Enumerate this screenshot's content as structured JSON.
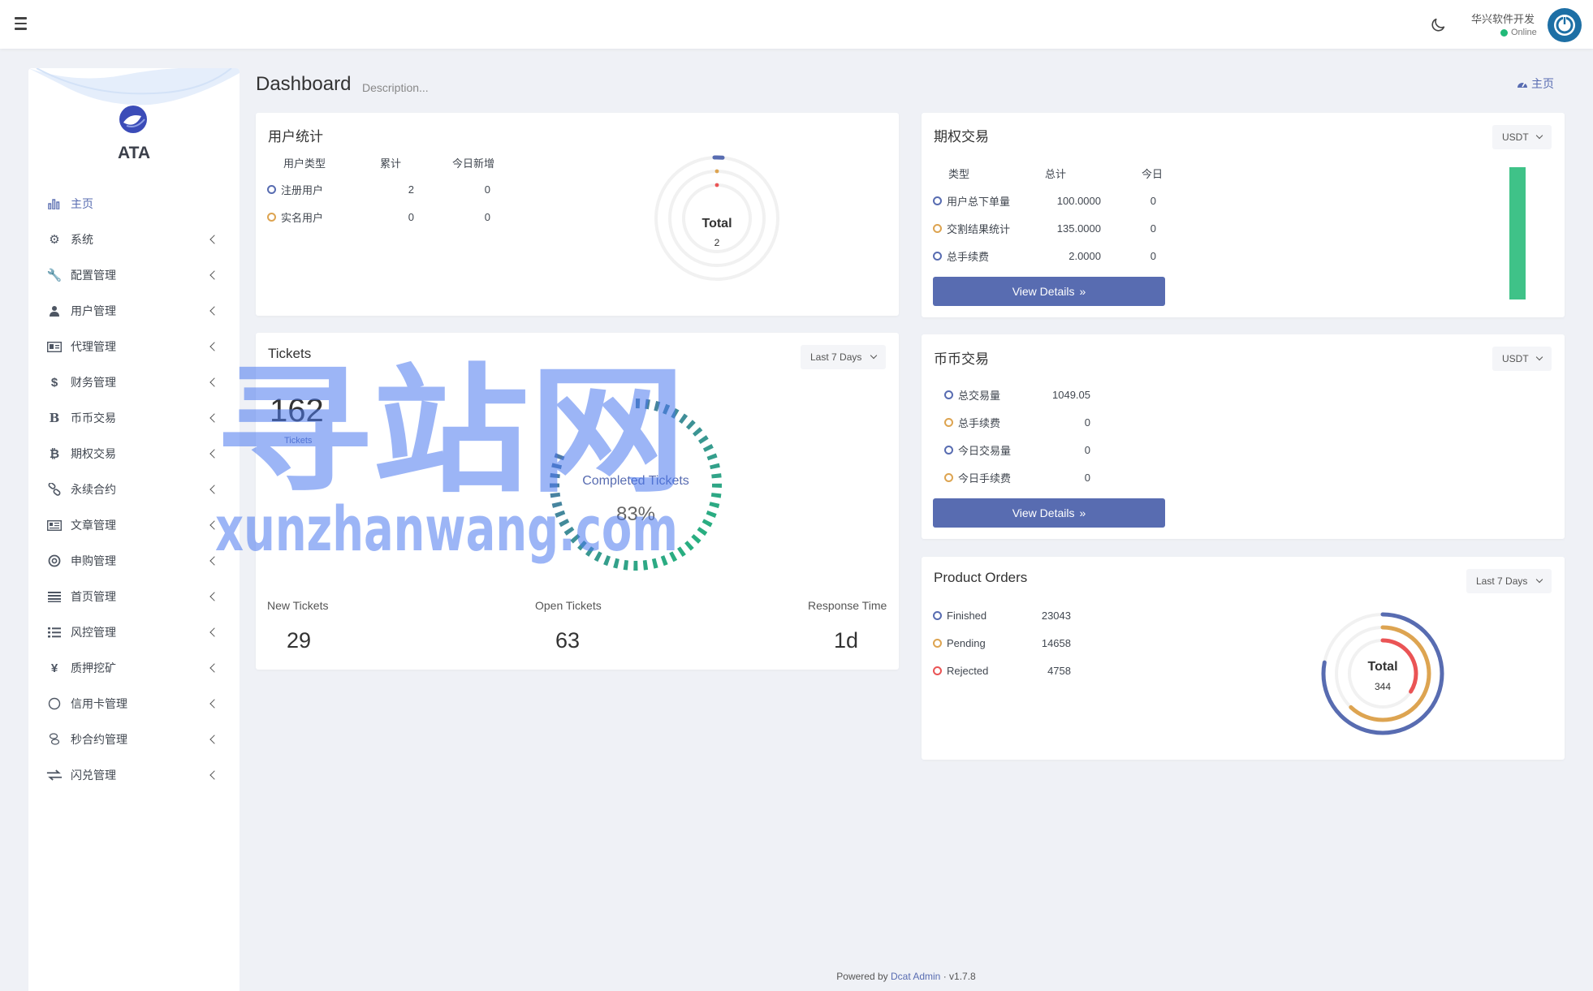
{
  "topbar": {
    "user_name": "华兴软件开发",
    "user_status": "Online"
  },
  "sidebar": {
    "logo_text": "ATA",
    "items": [
      {
        "label": "主页",
        "icon": "bar-chart-icon",
        "active": true
      },
      {
        "label": "系统",
        "icon": "gear-icon"
      },
      {
        "label": "配置管理",
        "icon": "wrench-icon"
      },
      {
        "label": "用户管理",
        "icon": "users-icon"
      },
      {
        "label": "代理管理",
        "icon": "id-card-icon"
      },
      {
        "label": "财务管理",
        "icon": "dollar-icon"
      },
      {
        "label": "币币交易",
        "icon": "bitcoin-b-icon"
      },
      {
        "label": "期权交易",
        "icon": "bitcoin-icon"
      },
      {
        "label": "永续合约",
        "icon": "link-icon"
      },
      {
        "label": "文章管理",
        "icon": "newspaper-icon"
      },
      {
        "label": "申购管理",
        "icon": "life-ring-icon"
      },
      {
        "label": "首页管理",
        "icon": "list-icon"
      },
      {
        "label": "风控管理",
        "icon": "list-ul-icon"
      },
      {
        "label": "质押挖矿",
        "icon": "yen-icon"
      },
      {
        "label": "信用卡管理",
        "icon": "circle-icon"
      },
      {
        "label": "秒合约管理",
        "icon": "money-icon"
      },
      {
        "label": "闪兑管理",
        "icon": "exchange-icon"
      }
    ]
  },
  "page": {
    "title": "Dashboard",
    "description": "Description...",
    "breadcrumb": "主页"
  },
  "user_stats": {
    "title": "用户统计",
    "headers": [
      "用户类型",
      "累计",
      "今日新增"
    ],
    "rows": [
      {
        "label": "注册用户",
        "total": "2",
        "today": "0",
        "color": "#586cb1"
      },
      {
        "label": "实名用户",
        "total": "0",
        "today": "0",
        "color": "#dda451"
      }
    ],
    "donut_label": "Total",
    "donut_value": "2"
  },
  "options_trade": {
    "title": "期权交易",
    "currency": "USDT",
    "headers": [
      "类型",
      "总计",
      "今日"
    ],
    "rows": [
      {
        "label": "用户总下单量",
        "total": "100.0000",
        "today": "0",
        "color": "#586cb1"
      },
      {
        "label": "交割结果统计",
        "total": "135.0000",
        "today": "0",
        "color": "#dda451"
      },
      {
        "label": "总手续费",
        "total": "2.0000",
        "today": "0",
        "color": "#586cb1"
      }
    ],
    "button": "View Details",
    "bar_color": "#3fc288"
  },
  "tickets": {
    "title": "Tickets",
    "range": "Last 7 Days",
    "count": "162",
    "count_label": "Tickets",
    "gauge_label": "Completed Tickets",
    "gauge_value": "83%",
    "stats": [
      {
        "label": "New Tickets",
        "value": "29"
      },
      {
        "label": "Open Tickets",
        "value": "63"
      },
      {
        "label": "Response Time",
        "value": "1d"
      }
    ]
  },
  "coin_trade": {
    "title": "币币交易",
    "currency": "USDT",
    "rows": [
      {
        "label": "总交易量",
        "value": "1049.05",
        "color": "#586cb1"
      },
      {
        "label": "总手续费",
        "value": "0",
        "color": "#dda451"
      },
      {
        "label": "今日交易量",
        "value": "0",
        "color": "#586cb1"
      },
      {
        "label": "今日手续费",
        "value": "0",
        "color": "#dda451"
      }
    ],
    "button": "View Details"
  },
  "product_orders": {
    "title": "Product Orders",
    "range": "Last 7 Days",
    "rows": [
      {
        "label": "Finished",
        "value": "23043",
        "color": "#586cb1"
      },
      {
        "label": "Pending",
        "value": "14658",
        "color": "#dda451"
      },
      {
        "label": "Rejected",
        "value": "4758",
        "color": "#ea5455"
      }
    ],
    "donut_label": "Total",
    "donut_value": "344"
  },
  "watermark": {
    "cn": "寻站网",
    "en": "xunzhanwang.com"
  },
  "footer": {
    "prefix": "Powered by",
    "link": "Dcat Admin",
    "version": "v1.7.8"
  }
}
